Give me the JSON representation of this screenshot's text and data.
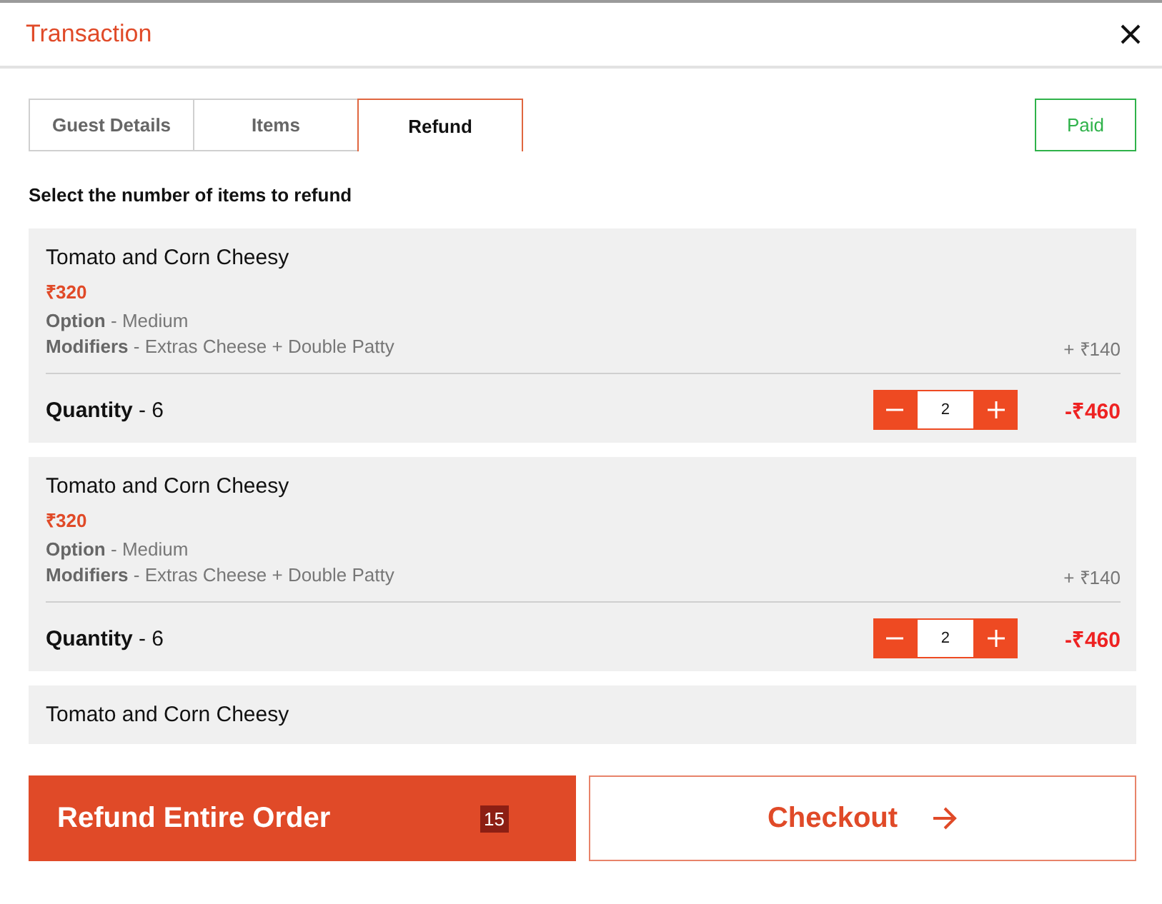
{
  "window": {
    "title": "Transaction"
  },
  "tabs": [
    {
      "label": "Guest Details",
      "selected": false
    },
    {
      "label": "Items",
      "selected": false
    },
    {
      "label": "Refund",
      "selected": true
    }
  ],
  "status": "Paid",
  "instruction": "Select the number of items to refund",
  "items": [
    {
      "name": "Tomato and Corn Cheesy",
      "price": "₹320",
      "option_label": "Option",
      "option": "- Medium",
      "modifiers_label": "Modifiers",
      "modifiers": "- Extras Cheese + Double Patty",
      "modifiers_price": "+ ₹140",
      "quantity_label": "Quantity",
      "quantity": "- 6",
      "refund_count": "2",
      "refund_amount": "-₹460"
    },
    {
      "name": "Tomato and Corn Cheesy",
      "price": "₹320",
      "option_label": "Option",
      "option": "- Medium",
      "modifiers_label": "Modifiers",
      "modifiers": "- Extras Cheese + Double Patty",
      "modifiers_price": "+ ₹140",
      "quantity_label": "Quantity",
      "quantity": "- 6",
      "refund_count": "2",
      "refund_amount": "-₹460"
    },
    {
      "name": "Tomato and Corn Cheesy"
    }
  ],
  "refund_button": {
    "label": "Refund Entire Order",
    "count": "15"
  },
  "checkout_button": {
    "label": "Checkout"
  }
}
